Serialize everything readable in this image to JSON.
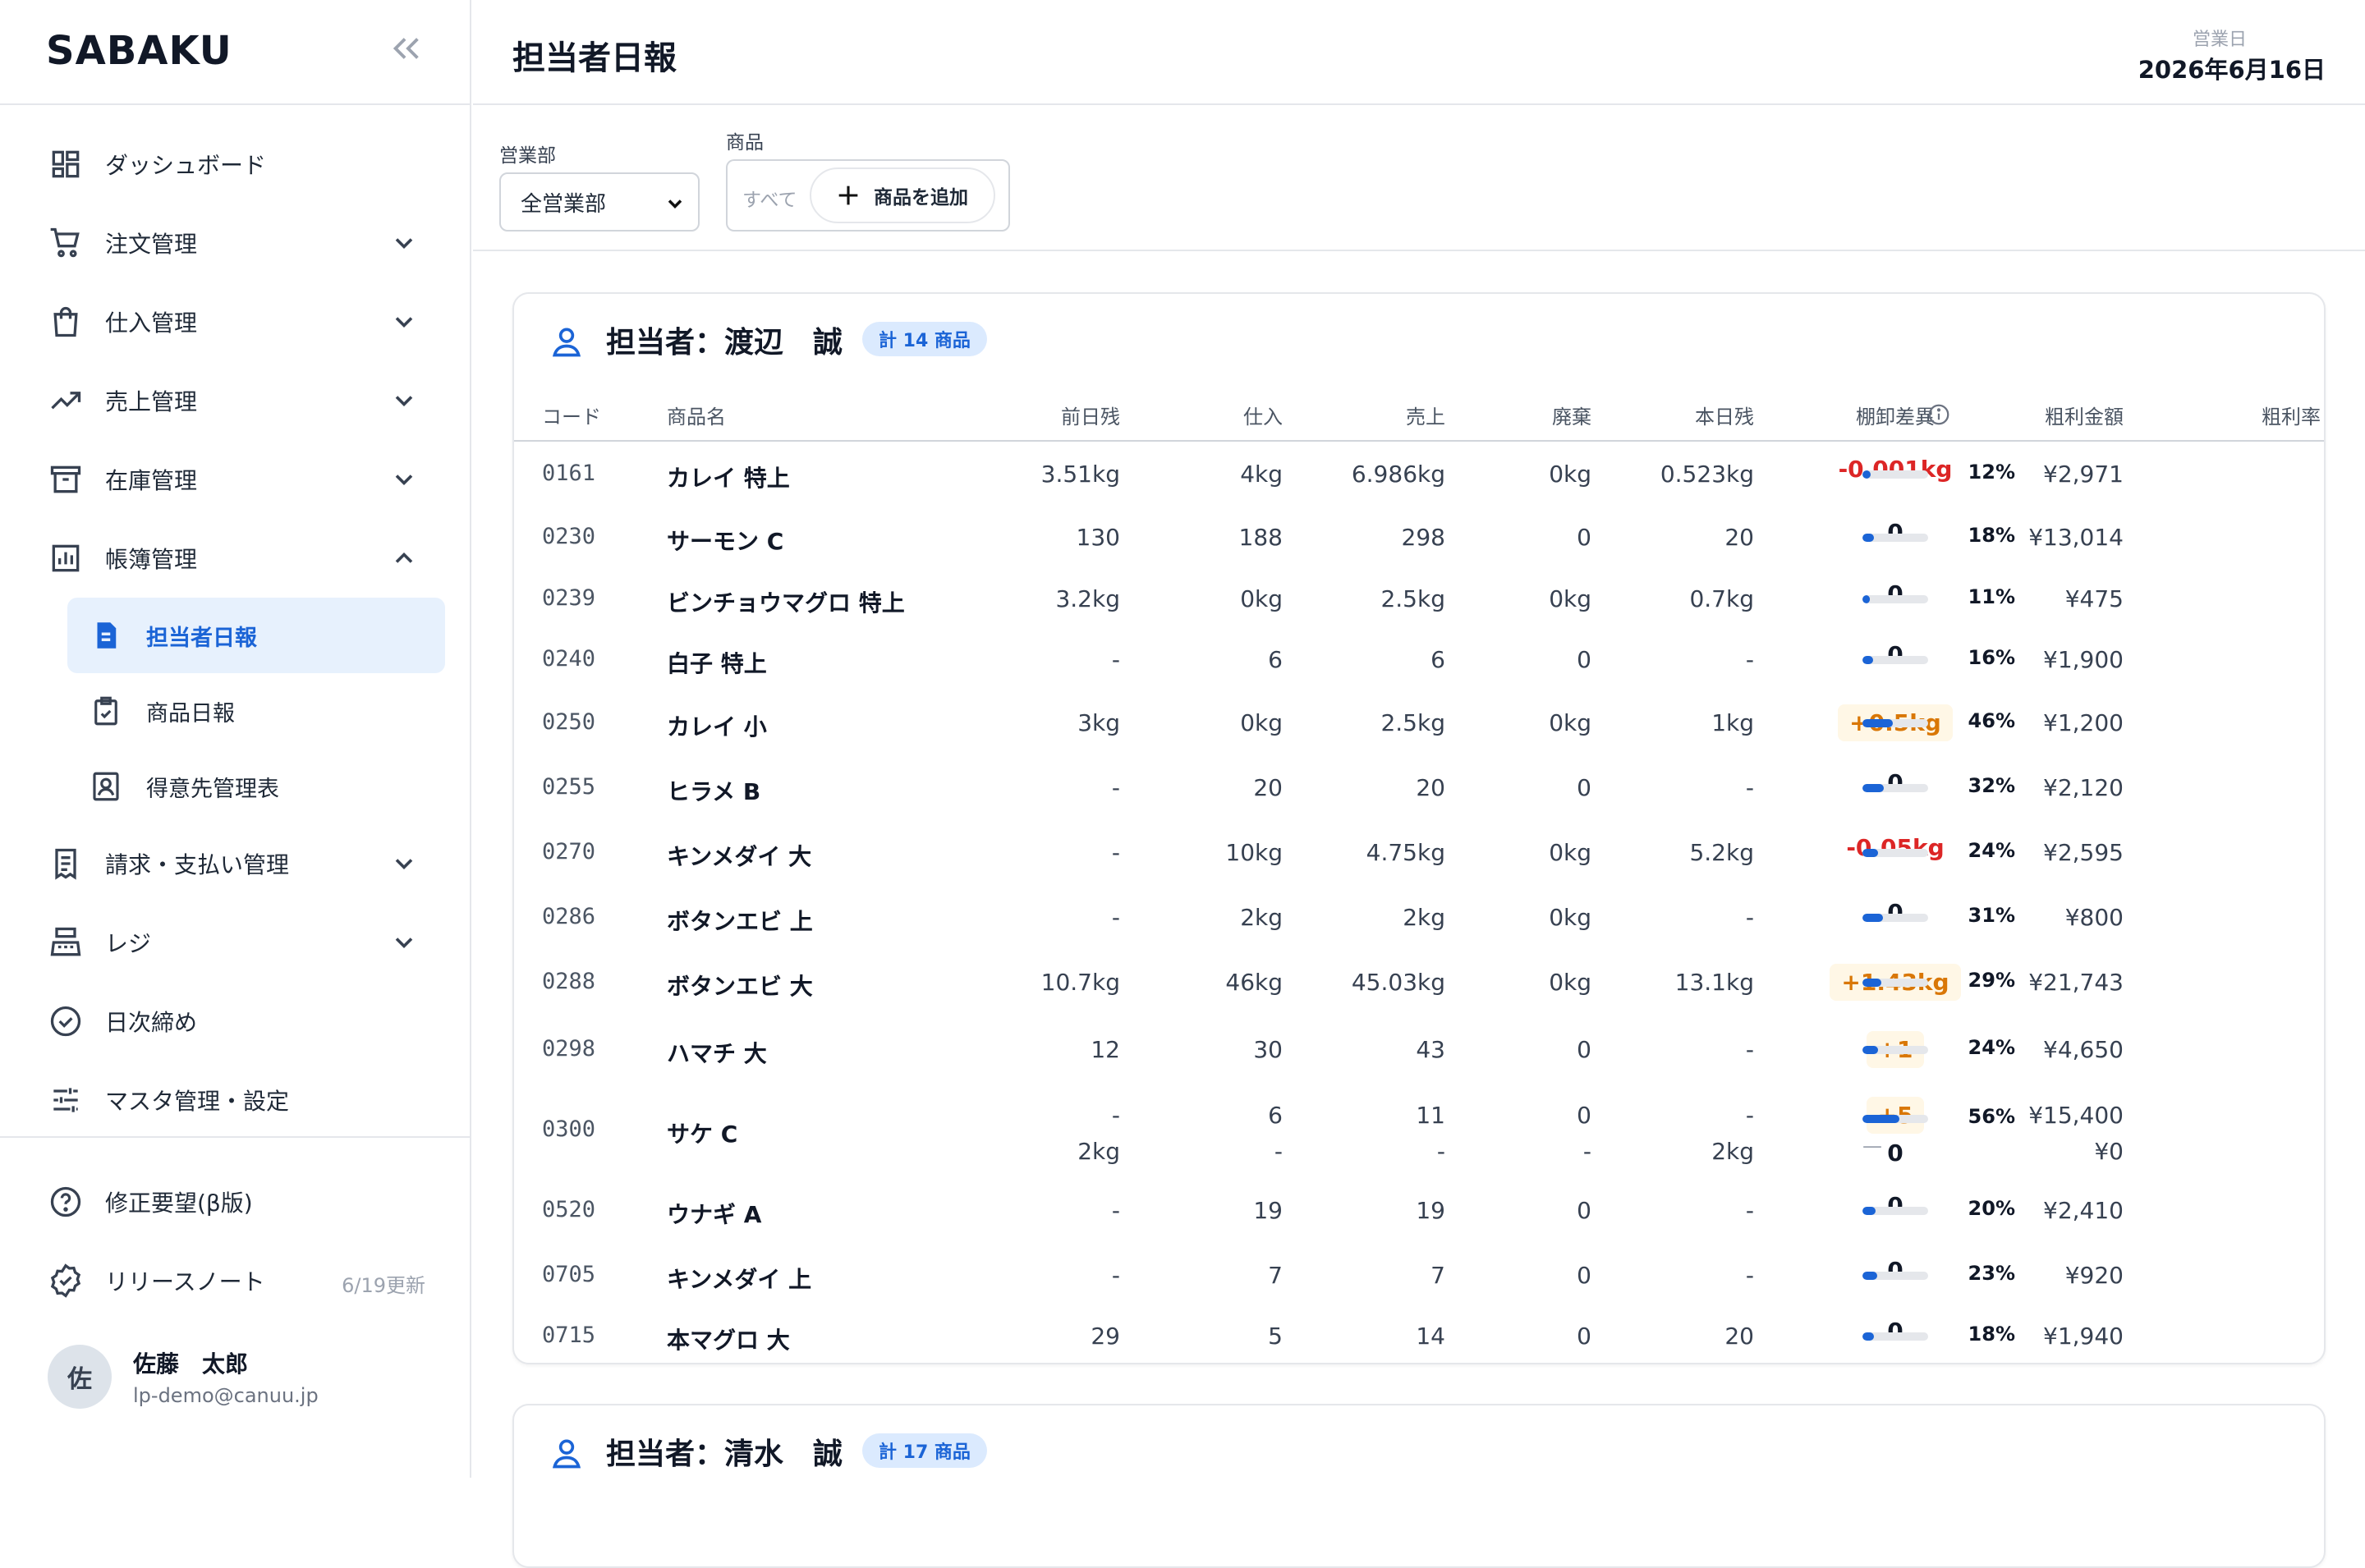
{
  "app": {
    "logo": "SABAKU"
  },
  "nav": [
    {
      "label": "ダッシュボード",
      "icon": "dashboard-icon",
      "chevron": ""
    },
    {
      "label": "注文管理",
      "icon": "cart-icon",
      "chevron": "down"
    },
    {
      "label": "仕入管理",
      "icon": "shopping-bag-icon",
      "chevron": "down"
    },
    {
      "label": "売上管理",
      "icon": "trending-up-icon",
      "chevron": "down"
    },
    {
      "label": "在庫管理",
      "icon": "archive-icon",
      "chevron": "down"
    },
    {
      "label": "帳簿管理",
      "icon": "bar-chart-icon",
      "chevron": "up"
    }
  ],
  "subnav": [
    {
      "label": "担当者日報",
      "icon": "document-icon",
      "active": true
    },
    {
      "label": "商品日報",
      "icon": "clipboard-check-icon",
      "active": false
    },
    {
      "label": "得意先管理表",
      "icon": "contact-card-icon",
      "active": false
    }
  ],
  "nav2": [
    {
      "label": "請求・支払い管理",
      "icon": "receipt-icon",
      "chevron": "down"
    },
    {
      "label": "レジ",
      "icon": "register-icon",
      "chevron": "down"
    },
    {
      "label": "日次締め",
      "icon": "check-circle-icon",
      "chevron": ""
    },
    {
      "label": "マスタ管理・設定",
      "icon": "sliders-icon",
      "chevron": ""
    }
  ],
  "bottom": {
    "help": "修正要望(β版)",
    "release": "リリースノート",
    "release_update": "6/19更新"
  },
  "user": {
    "initial": "佐",
    "name": "佐藤　太郎",
    "email": "lp-demo@canuu.jp"
  },
  "header": {
    "title": "担当者日報",
    "business_day_label": "営業日",
    "business_day": "2026年6月16日"
  },
  "filters": {
    "dept_label": "営業部",
    "dept_value": "全営業部",
    "product_label": "商品",
    "product_all": "すべて",
    "add_product": "商品を追加"
  },
  "columns": [
    "コード",
    "商品名",
    "前日残",
    "仕入",
    "売上",
    "廃棄",
    "本日残",
    "棚卸差異",
    "粗利金額",
    "粗利率"
  ],
  "cards": [
    {
      "name": "担当者：渡辺　誠",
      "badge": "計 14 商品",
      "rows": [
        {
          "code": "0161",
          "name": "カレイ 特上",
          "prev": "3.51kg",
          "purchase": "4kg",
          "sales": "6.986kg",
          "waste": "0kg",
          "today": "0.523kg",
          "diff": "-0.001kg",
          "diff_type": "neg",
          "profit": "¥2,971",
          "rate": 12
        },
        {
          "code": "0230",
          "name": "サーモン C",
          "prev": "130",
          "purchase": "188",
          "sales": "298",
          "waste": "0",
          "today": "20",
          "diff": "0",
          "diff_type": "zero",
          "profit": "¥13,014",
          "rate": 18
        },
        {
          "code": "0239",
          "name": "ビンチョウマグロ 特上",
          "prev": "3.2kg",
          "purchase": "0kg",
          "sales": "2.5kg",
          "waste": "0kg",
          "today": "0.7kg",
          "diff": "0",
          "diff_type": "zero",
          "profit": "¥475",
          "rate": 11
        },
        {
          "code": "0240",
          "name": "白子 特上",
          "prev": "-",
          "purchase": "6",
          "sales": "6",
          "waste": "0",
          "today": "-",
          "diff": "0",
          "diff_type": "zero",
          "profit": "¥1,900",
          "rate": 16
        },
        {
          "code": "0250",
          "name": "カレイ 小",
          "prev": "3kg",
          "purchase": "0kg",
          "sales": "2.5kg",
          "waste": "0kg",
          "today": "1kg",
          "diff": "+0.5kg",
          "diff_type": "pos",
          "profit": "¥1,200",
          "rate": 46
        },
        {
          "code": "0255",
          "name": "ヒラメ B",
          "prev": "-",
          "purchase": "20",
          "sales": "20",
          "waste": "0",
          "today": "-",
          "diff": "0",
          "diff_type": "zero",
          "profit": "¥2,120",
          "rate": 32
        },
        {
          "code": "0270",
          "name": "キンメダイ 大",
          "prev": "-",
          "purchase": "10kg",
          "sales": "4.75kg",
          "waste": "0kg",
          "today": "5.2kg",
          "diff": "-0.05kg",
          "diff_type": "neg",
          "profit": "¥2,595",
          "rate": 24
        },
        {
          "code": "0286",
          "name": "ボタンエビ 上",
          "prev": "-",
          "purchase": "2kg",
          "sales": "2kg",
          "waste": "0kg",
          "today": "-",
          "diff": "0",
          "diff_type": "zero",
          "profit": "¥800",
          "rate": 31
        },
        {
          "code": "0288",
          "name": "ボタンエビ 大",
          "prev": "10.7kg",
          "purchase": "46kg",
          "sales": "45.03kg",
          "waste": "0kg",
          "today": "13.1kg",
          "diff": "+1.43kg",
          "diff_type": "pos",
          "profit": "¥21,743",
          "rate": 29
        },
        {
          "code": "0298",
          "name": "ハマチ 大",
          "prev": "12",
          "purchase": "30",
          "sales": "43",
          "waste": "0",
          "today": "-",
          "diff": "+1",
          "diff_type": "pos",
          "profit": "¥4,650",
          "rate": 24
        },
        {
          "code": "0300",
          "name": "サケ C",
          "prev": "-",
          "purchase": "6",
          "sales": "11",
          "waste": "0",
          "today": "-",
          "diff": "+5",
          "diff_type": "pos",
          "profit": "¥15,400",
          "rate": 56,
          "second": {
            "prev": "2kg",
            "purchase": "-",
            "sales": "-",
            "waste": "-",
            "today": "2kg",
            "diff": "0",
            "profit": "¥0",
            "rate_text": "—"
          }
        },
        {
          "code": "0520",
          "name": "ウナギ A",
          "prev": "-",
          "purchase": "19",
          "sales": "19",
          "waste": "0",
          "today": "-",
          "diff": "0",
          "diff_type": "zero",
          "profit": "¥2,410",
          "rate": 20
        },
        {
          "code": "0705",
          "name": "キンメダイ 上",
          "prev": "-",
          "purchase": "7",
          "sales": "7",
          "waste": "0",
          "today": "-",
          "diff": "0",
          "diff_type": "zero",
          "profit": "¥920",
          "rate": 23
        },
        {
          "code": "0715",
          "name": "本マグロ 大",
          "prev": "29",
          "purchase": "5",
          "sales": "14",
          "waste": "0",
          "today": "20",
          "diff": "0",
          "diff_type": "zero",
          "profit": "¥1,940",
          "rate": 18
        }
      ]
    },
    {
      "name": "担当者：清水　誠",
      "badge": "計 17 商品",
      "rows": []
    }
  ],
  "colors": {
    "accent": "#1b64d6",
    "negative": "#dc2626",
    "positive": "#d97706"
  }
}
